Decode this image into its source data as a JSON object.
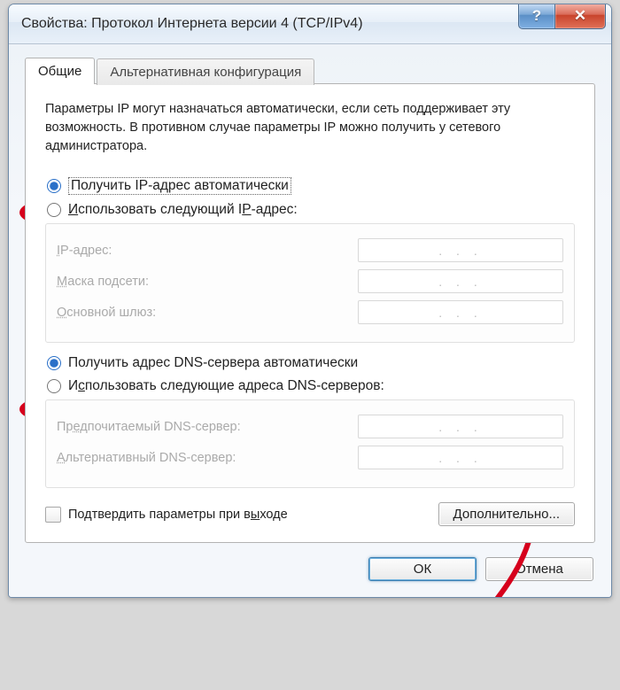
{
  "window": {
    "title": "Свойства: Протокол Интернета версии 4 (TCP/IPv4)"
  },
  "tabs": {
    "general": "Общие",
    "alternate": "Альтернативная конфигурация"
  },
  "intro": "Параметры IP могут назначаться автоматически, если сеть поддерживает эту возможность. В противном случае параметры IP можно получить у сетевого администратора.",
  "ip": {
    "auto_label": "Получить IP-адрес автоматически",
    "manual_label": "Использовать следующий IP-адрес:",
    "fields": {
      "ip": "IP-адрес:",
      "mask": "Маска подсети:",
      "gateway": "Основной шлюз:"
    }
  },
  "dns": {
    "auto_label": "Получить адрес DNS-сервера автоматически",
    "manual_label": "Использовать следующие адреса DNS-серверов:",
    "fields": {
      "preferred": "Предпочитаемый DNS-сервер:",
      "alternate": "Альтернативный DNS-сервер:"
    }
  },
  "ip_placeholder": ".   .   .",
  "confirm_label": "Подтвердить параметры при выходе",
  "advanced_btn": "Дополнительно...",
  "ok_btn": "ОК",
  "cancel_btn": "Отмена",
  "annotation_color": "#d6001c"
}
